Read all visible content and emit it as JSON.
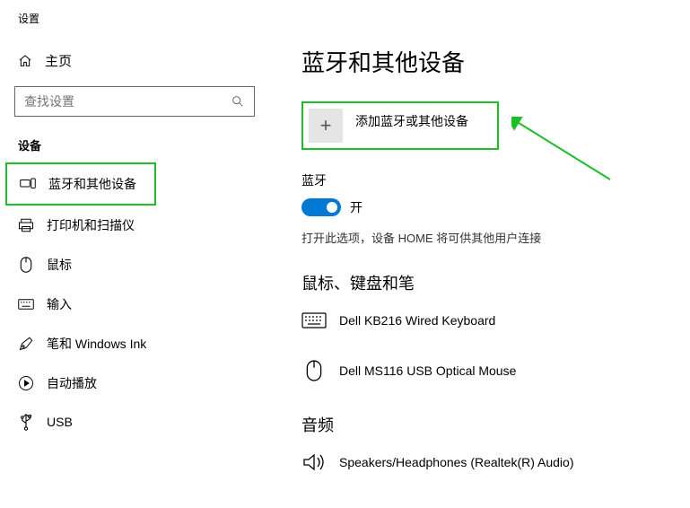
{
  "app": {
    "title": "设置"
  },
  "sidebar": {
    "home_label": "主页",
    "search_placeholder": "查找设置",
    "section_label": "设备",
    "items": [
      {
        "label": "蓝牙和其他设备"
      },
      {
        "label": "打印机和扫描仪"
      },
      {
        "label": "鼠标"
      },
      {
        "label": "输入"
      },
      {
        "label": "笔和 Windows Ink"
      },
      {
        "label": "自动播放"
      },
      {
        "label": "USB"
      }
    ]
  },
  "main": {
    "title": "蓝牙和其他设备",
    "add_button_label": "添加蓝牙或其他设备",
    "bluetooth": {
      "label": "蓝牙",
      "toggle_text": "开",
      "helper": "打开此选项，设备 HOME 将可供其他用户连接"
    },
    "group1": {
      "title": "鼠标、键盘和笔",
      "device1": "Dell KB216 Wired Keyboard",
      "device2": "Dell MS116 USB Optical Mouse"
    },
    "group2": {
      "title": "音频",
      "device1": "Speakers/Headphones (Realtek(R) Audio)"
    }
  }
}
